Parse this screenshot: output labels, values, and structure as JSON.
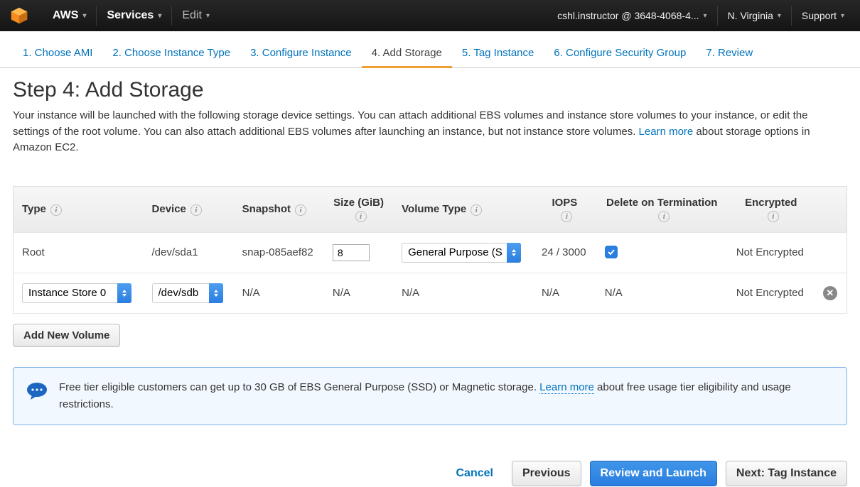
{
  "topnav": {
    "aws": "AWS",
    "services": "Services",
    "edit": "Edit",
    "account": "cshl.instructor @ 3648-4068-4...",
    "region": "N. Virginia",
    "support": "Support"
  },
  "wizard": [
    {
      "label": "1. Choose AMI"
    },
    {
      "label": "2. Choose Instance Type"
    },
    {
      "label": "3. Configure Instance"
    },
    {
      "label": "4. Add Storage",
      "active": true
    },
    {
      "label": "5. Tag Instance"
    },
    {
      "label": "6. Configure Security Group"
    },
    {
      "label": "7. Review"
    }
  ],
  "heading": "Step 4: Add Storage",
  "desc_a": "Your instance will be launched with the following storage device settings. You can attach additional EBS volumes and instance store volumes to your instance, or edit the settings of the root volume. You can also attach additional EBS volumes after launching an instance, but not instance store volumes. ",
  "desc_learn": "Learn more",
  "desc_b": " about storage options in Amazon EC2.",
  "headers": {
    "type": "Type",
    "device": "Device",
    "snapshot": "Snapshot",
    "size": "Size (GiB)",
    "voltype": "Volume Type",
    "iops": "IOPS",
    "delete": "Delete on Termination",
    "encrypted": "Encrypted"
  },
  "row_root": {
    "type": "Root",
    "device": "/dev/sda1",
    "snapshot": "snap-085aef82",
    "size": "8",
    "voltype": "General Purpose (SSD)",
    "iops": "24 / 3000",
    "encrypted": "Not Encrypted"
  },
  "row_instore": {
    "type": "Instance Store 0",
    "device": "/dev/sdb",
    "snapshot": "N/A",
    "size": "N/A",
    "voltype": "N/A",
    "iops": "N/A",
    "delete": "N/A",
    "encrypted": "Not Encrypted"
  },
  "add_volume": "Add New Volume",
  "info_a": "Free tier eligible customers can get up to 30 GB of EBS General Purpose (SSD) or Magnetic storage. ",
  "info_learn": "Learn more",
  "info_b": " about free usage tier eligibility and usage restrictions.",
  "footer": {
    "cancel": "Cancel",
    "previous": "Previous",
    "review": "Review and Launch",
    "next": "Next: Tag Instance"
  }
}
